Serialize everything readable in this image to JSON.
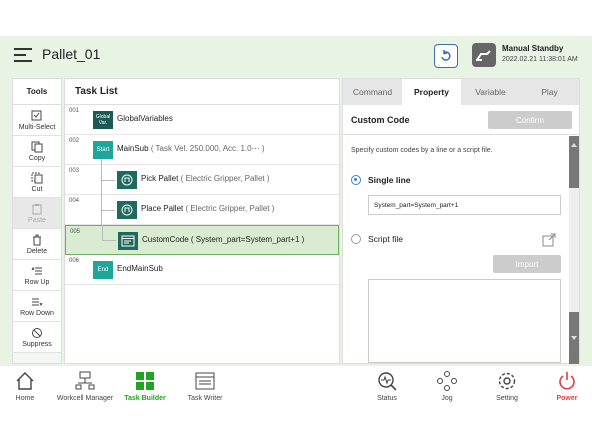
{
  "header": {
    "title": "Pallet_01",
    "status": "Manual Standby",
    "datetime": "2022.02.21 11:38:01 AM"
  },
  "tools": {
    "title": "Tools",
    "items": [
      {
        "label": "Multi-Select",
        "icon": "multiselect-icon",
        "enabled": true
      },
      {
        "label": "Copy",
        "icon": "copy-icon",
        "enabled": true
      },
      {
        "label": "Cut",
        "icon": "cut-icon",
        "enabled": true
      },
      {
        "label": "Paste",
        "icon": "paste-icon",
        "enabled": false
      },
      {
        "label": "Delete",
        "icon": "delete-icon",
        "enabled": true
      },
      {
        "label": "Row Up",
        "icon": "row-up-icon",
        "enabled": true
      },
      {
        "label": "Row Down",
        "icon": "row-down-icon",
        "enabled": true
      },
      {
        "label": "Suppress",
        "icon": "suppress-icon",
        "enabled": true
      }
    ]
  },
  "tasklist": {
    "title": "Task List",
    "rows": [
      {
        "num": "001",
        "badge": "Global Var.",
        "name": "GlobalVariables",
        "param": ""
      },
      {
        "num": "002",
        "badge": "Start",
        "name": "MainSub",
        "param": "( Task Vel. 250.000, Acc. 1.0⋯ )"
      },
      {
        "num": "003",
        "badge": "",
        "name": "Pick Pallet",
        "param": "( Electric Gripper, Pallet )"
      },
      {
        "num": "004",
        "badge": "",
        "name": "Place Pallet",
        "param": "( Electric Gripper, Pallet )"
      },
      {
        "num": "005",
        "badge": "",
        "name": "CustomCode",
        "param": "( System_part=System_part+1 )"
      },
      {
        "num": "006",
        "badge": "End",
        "name": "EndMainSub",
        "param": ""
      }
    ]
  },
  "panel": {
    "tabs": [
      "Command",
      "Property",
      "Variable",
      "Play"
    ],
    "active_tab": "Property",
    "title": "Custom Code",
    "confirm": "Confirm",
    "description": "Specify custom codes by a line or a script file.",
    "single_line_label": "Single line",
    "single_line_value": "System_part=System_part+1",
    "script_file_label": "Script file",
    "import": "Import"
  },
  "nav": {
    "items": [
      {
        "label": "Home",
        "icon": "home-icon"
      },
      {
        "label": "Workcell Manager",
        "icon": "workcell-icon"
      },
      {
        "label": "Task Builder",
        "icon": "task-builder-icon"
      },
      {
        "label": "Task Writer",
        "icon": "task-writer-icon"
      },
      {
        "label": "Status",
        "icon": "status-icon"
      },
      {
        "label": "Jog",
        "icon": "jog-icon"
      },
      {
        "label": "Setting",
        "icon": "setting-icon"
      },
      {
        "label": "Power",
        "icon": "power-icon"
      }
    ]
  },
  "colors": {
    "accent_green": "#22a322",
    "header_bg": "#e9f3e3",
    "teal_badge": "#1f8a7a",
    "dark_badge": "#1e5a54",
    "selection": "#d9ecd2",
    "power_red": "#e04040",
    "radio_blue": "#3a7bd5"
  }
}
